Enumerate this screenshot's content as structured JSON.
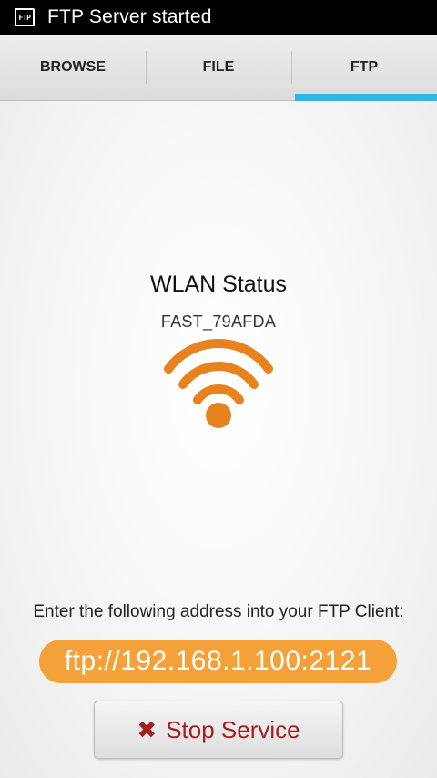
{
  "status_bar": {
    "notification_icon": "ftp-icon",
    "notification_icon_text": "FTP",
    "message": "FTP Server started"
  },
  "tabs": [
    {
      "label": "BROWSE",
      "selected": false
    },
    {
      "label": "FILE",
      "selected": false
    },
    {
      "label": "FTP",
      "selected": true
    }
  ],
  "wlan": {
    "title": "WLAN Status",
    "ssid": "FAST_79AFDA",
    "icon": "wifi-icon"
  },
  "ftp": {
    "instruction": "Enter the following address into your FTP Client:",
    "address": "ftp://192.168.1.100:2121"
  },
  "stop_button": {
    "icon": "close-x-icon",
    "icon_glyph": "✖",
    "label": "Stop Service"
  },
  "colors": {
    "accent": "#33b5e5",
    "address_pill": "#f5a13a",
    "wifi": "#e8821e",
    "stop_text": "#a51d1d"
  }
}
